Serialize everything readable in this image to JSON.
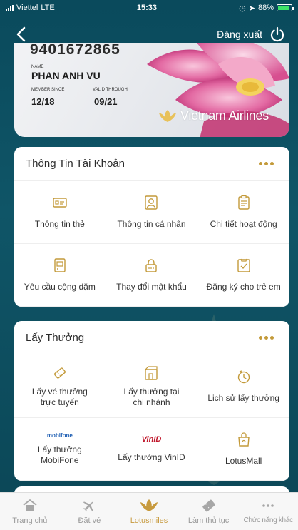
{
  "status_bar": {
    "carrier": "Viettel",
    "network": "LTE",
    "time": "15:33",
    "battery": "88%",
    "battery_level": 0.88
  },
  "header": {
    "logout_label": "Đăng xuất",
    "back_icon": "chevron-left-icon",
    "logout_icon": "power-icon"
  },
  "card": {
    "number": "9401672865",
    "name_label": "NAME",
    "name": "PHAN ANH VU",
    "member_since_label": "MEMBER SINCE",
    "member_since": "12/18",
    "valid_through_label": "VALID THROUGH",
    "valid_through": "09/21",
    "brand": "Vietnam Airlines"
  },
  "account_panel": {
    "title": "Thông Tin Tài Khoản",
    "items": [
      {
        "label": "Thông tin thẻ",
        "icon": "card-icon"
      },
      {
        "label": "Thông tin cá nhân",
        "icon": "person-icon"
      },
      {
        "label": "Chi tiết hoạt động",
        "icon": "clipboard-icon"
      },
      {
        "label": "Yêu cầu cộng dặm",
        "icon": "request-icon"
      },
      {
        "label": "Thay đổi mật khẩu",
        "icon": "lock-icon"
      },
      {
        "label": "Đăng ký cho trẻ em",
        "icon": "register-child-icon"
      }
    ]
  },
  "rewards_panel": {
    "title": "Lấy Thưởng",
    "items": [
      {
        "label": "Lấy vé thưởng\ntrực tuyến",
        "icon": "ticket-icon"
      },
      {
        "label": "Lấy thưởng tại\nchi nhánh",
        "icon": "branch-icon"
      },
      {
        "label": "Lịch sử lấy thưởng",
        "icon": "clock-icon"
      },
      {
        "label": "Lấy thưởng\nMobiFone",
        "icon": "mobifone-logo",
        "logo_text": "mobifone"
      },
      {
        "label": "Lấy thưởng VinID",
        "icon": "vinid-logo",
        "logo_text": "VinID"
      },
      {
        "label": "LotusMall",
        "icon": "shopping-bag-icon"
      }
    ]
  },
  "tabbar": {
    "items": [
      {
        "label": "Trang chủ",
        "icon": "home-icon",
        "active": false
      },
      {
        "label": "Đặt vé",
        "icon": "plane-icon",
        "active": false
      },
      {
        "label": "Lotusmiles",
        "icon": "lotus-icon",
        "active": true
      },
      {
        "label": "Làm thủ tục",
        "icon": "checkin-icon",
        "active": false
      },
      {
        "label": "Chức năng khác",
        "icon": "more-icon",
        "active": false
      }
    ]
  },
  "colors": {
    "accent": "#c39a3a",
    "background": "#0f5567",
    "tab_active": "#c79a3e",
    "tab_inactive": "#9a9a9a"
  }
}
